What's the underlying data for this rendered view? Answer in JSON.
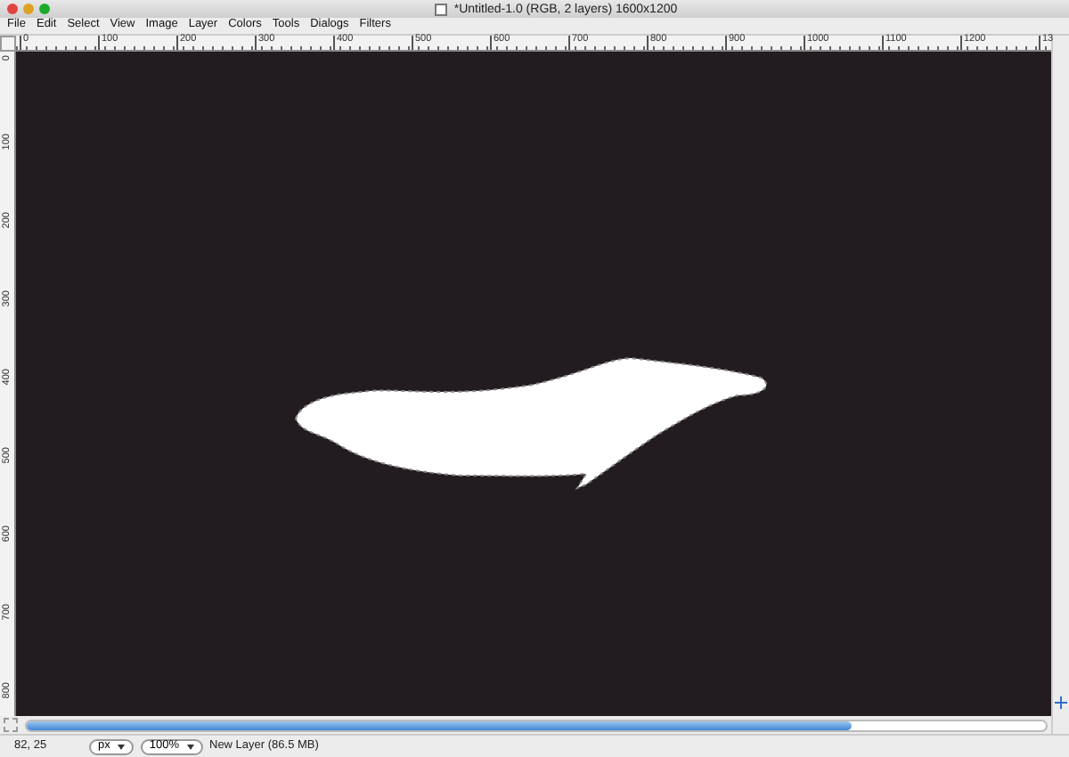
{
  "window": {
    "title": "*Untitled-1.0 (RGB, 2 layers) 1600x1200"
  },
  "menu": [
    "File",
    "Edit",
    "Select",
    "View",
    "Image",
    "Layer",
    "Colors",
    "Tools",
    "Dialogs",
    "Filters"
  ],
  "horizontal_ruler": [
    "0",
    "100",
    "200",
    "300",
    "400",
    "500",
    "600",
    "700",
    "800",
    "900",
    "1000",
    "1100",
    "1200",
    "13"
  ],
  "vertical_ruler": [
    "0",
    "100",
    "200",
    "300",
    "400",
    "500",
    "600",
    "700",
    "800"
  ],
  "status_bar": {
    "pointer": "82, 25",
    "unit": "px",
    "zoom": "100%",
    "message": "New Layer (86.5 MB)"
  }
}
